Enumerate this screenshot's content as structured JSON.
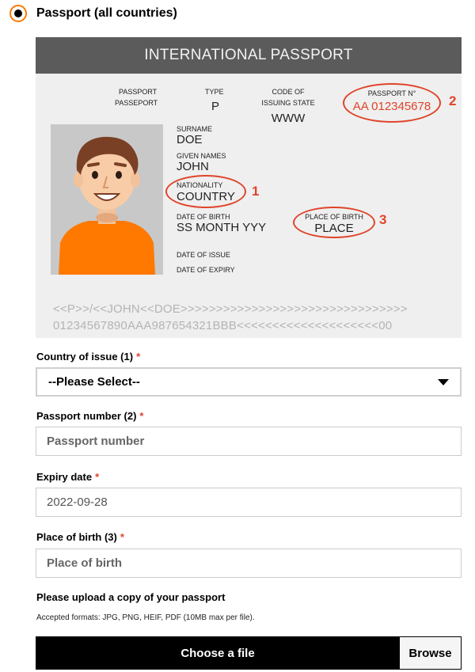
{
  "option": {
    "label": "Passport (all countries)",
    "selected": true
  },
  "passport_image": {
    "title": "INTERNATIONAL PASSPORT",
    "fields": {
      "passport_label_line1": "PASSPORT",
      "passport_label_line2": "PASSEPORT",
      "type_label": "TYPE",
      "type_value": "P",
      "code_label_line1": "CODE OF",
      "code_label_line2": "ISSUING STATE",
      "code_value": "WWW",
      "passport_no_label": "PASSPORT N°",
      "passport_no_value": "AA 012345678",
      "surname_label": "SURNAME",
      "surname_value": "DOE",
      "given_names_label": "GIVEN NAMES",
      "given_names_value": "JOHN",
      "nationality_label": "NATIONALITY",
      "nationality_value": "COUNTRY",
      "dob_label": "DATE OF BIRTH",
      "dob_value": "SS MONTH YYY",
      "pob_label": "PLACE OF BIRTH",
      "pob_value": "PLACE",
      "issue_label": "DATE OF ISSUE",
      "expiry_label": "DATE OF EXPIRY"
    },
    "markers": [
      "1",
      "2",
      "3"
    ],
    "mrz_line1": "<<P>>/<<JOHN<<DOE>>>>>>>>>>>>>>>>>>>>>>>>>>>>>>>>",
    "mrz_line2": "01234567890AAA987654321BBB<<<<<<<<<<<<<<<<<<<<00",
    "colors": {
      "highlight": "#e0442a",
      "header": "#5b5b5b",
      "shirt": "#ff7900"
    }
  },
  "form": {
    "country": {
      "label": "Country of issue (1)",
      "required": "*",
      "value": "--Please Select--"
    },
    "passport_number": {
      "label": "Passport number (2)",
      "required": "*",
      "placeholder": "Passport number"
    },
    "expiry": {
      "label": "Expiry date",
      "required": "*",
      "value": "2022-09-28"
    },
    "place_of_birth": {
      "label": "Place of birth (3)",
      "required": "*",
      "placeholder": "Place of birth"
    }
  },
  "upload": {
    "title": "Please upload a copy of your passport",
    "help": "Accepted formats: JPG, PNG, HEIF, PDF (10MB max per file).",
    "choose_label": "Choose a file",
    "browse_label": "Browse"
  },
  "colors": {
    "accent": "#ff7900",
    "required": "#e0442a"
  }
}
